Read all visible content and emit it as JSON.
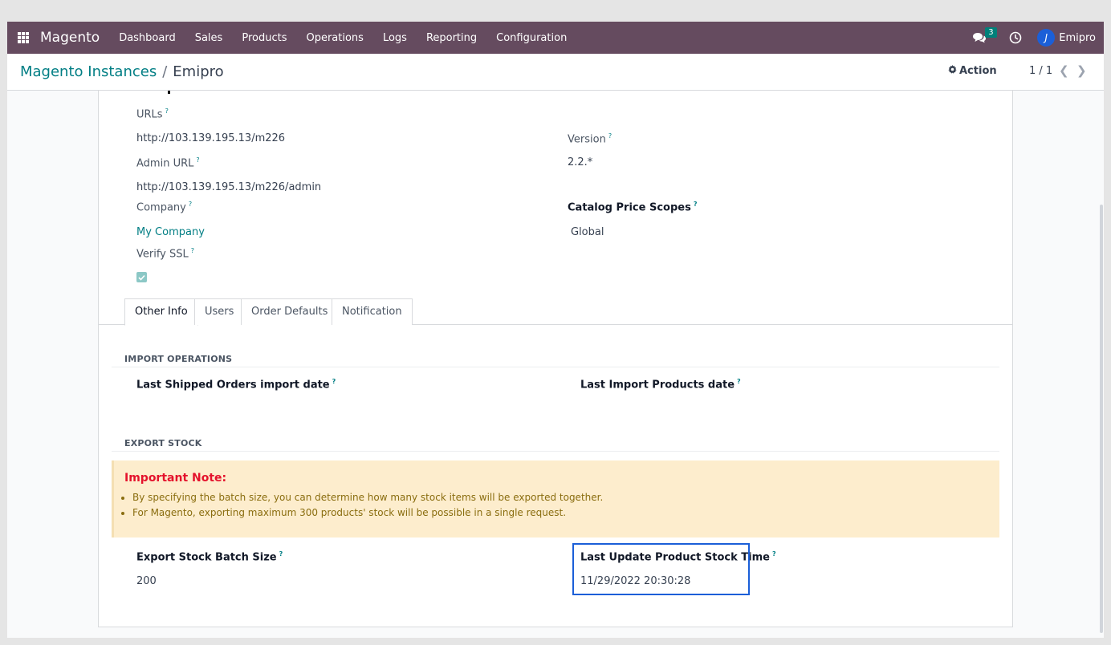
{
  "navbar": {
    "brand": "Magento",
    "menu": [
      "Dashboard",
      "Sales",
      "Products",
      "Operations",
      "Logs",
      "Reporting",
      "Configuration"
    ],
    "chat_count": "3",
    "user_name": "Emipro",
    "user_initial": "J",
    "bar_color": "#654b5f"
  },
  "control": {
    "breadcrumb_parent": "Magento Instances",
    "breadcrumb_sep": "/",
    "breadcrumb_current": "Emipro",
    "action_label": "Action",
    "pager": "1 / 1"
  },
  "form": {
    "urls_label": "URLs",
    "url_value": "http://103.139.195.13/m226",
    "admin_url_label": "Admin URL",
    "admin_url_value": "http://103.139.195.13/m226/admin",
    "company_label": "Company",
    "company_value": "My Company",
    "verify_ssl_label": "Verify SSL",
    "verify_ssl_checked": true,
    "version_label": "Version",
    "version_value": "2.2.*",
    "catalog_price_scopes_label": "Catalog Price Scopes",
    "catalog_price_scopes_value": "Global"
  },
  "tabs": [
    "Other Info",
    "Users",
    "Order Defaults",
    "Notification"
  ],
  "import_section": {
    "title": "IMPORT OPERATIONS",
    "last_shipped_label": "Last Shipped Orders import date",
    "last_import_products_label": "Last Import Products date"
  },
  "export_section": {
    "title": "EXPORT STOCK",
    "note_title": "Important Note:",
    "note_items": [
      "By specifying the batch size, you can determine how many stock items will be exported together.",
      "For Magento, exporting maximum 300 products' stock will be possible in a single request."
    ],
    "batch_size_label": "Export Stock Batch Size",
    "batch_size_value": "200",
    "last_update_label": "Last Update Product Stock Time",
    "last_update_value": "11/29/2022 20:30:28"
  },
  "help_mark": "?"
}
